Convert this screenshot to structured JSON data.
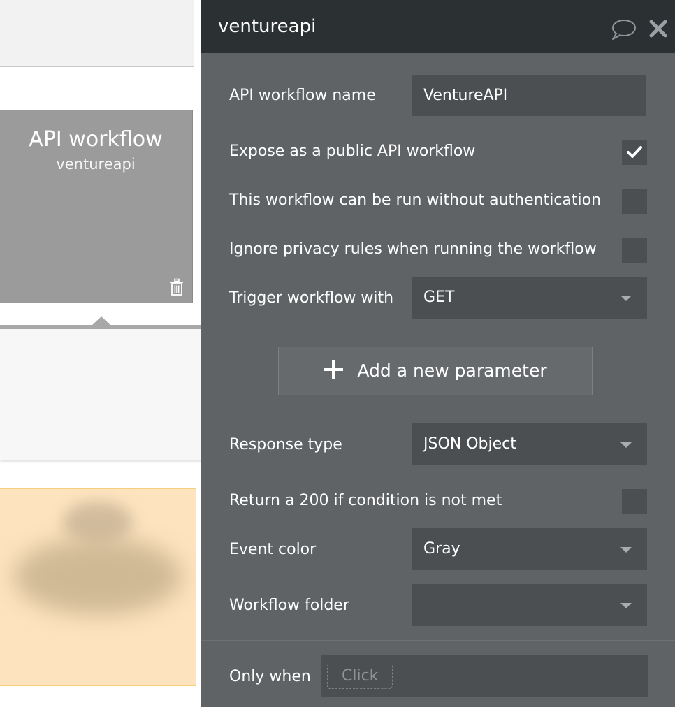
{
  "canvas": {
    "api_card": {
      "title": "API workflow",
      "subtitle": "ventureapi"
    }
  },
  "panel": {
    "title": "ventureapi",
    "fields": {
      "workflow_name": {
        "label": "API workflow name",
        "value": "VentureAPI"
      },
      "expose_public": {
        "label": "Expose as a public API workflow",
        "checked": true
      },
      "no_auth": {
        "label": "This workflow can be run without authentication",
        "checked": false
      },
      "ignore_privacy": {
        "label": "Ignore privacy rules when running the workflow",
        "checked": false
      },
      "trigger": {
        "label": "Trigger workflow with",
        "value": "GET"
      },
      "response_type": {
        "label": "Response type",
        "value": "JSON Object"
      },
      "return_200": {
        "label": "Return a 200 if condition is not met",
        "checked": false
      },
      "event_color": {
        "label": "Event color",
        "value": "Gray"
      },
      "workflow_folder": {
        "label": "Workflow folder",
        "value": ""
      },
      "only_when": {
        "label": "Only when",
        "placeholder": "Click"
      }
    },
    "add_parameter_label": "Add a new parameter"
  },
  "icons": {
    "comment": "comment-bubble-icon",
    "close": "close-icon",
    "trash": "trash-icon",
    "check": "checkmark-icon",
    "plus": "plus-icon",
    "caret": "chevron-down-icon"
  },
  "colors": {
    "panel_bg": "#5f6366",
    "header_bg": "#2b3033",
    "field_bg": "#4b4f52",
    "card_gray": "#9b9b9b",
    "card_orange": "#fde3be"
  }
}
